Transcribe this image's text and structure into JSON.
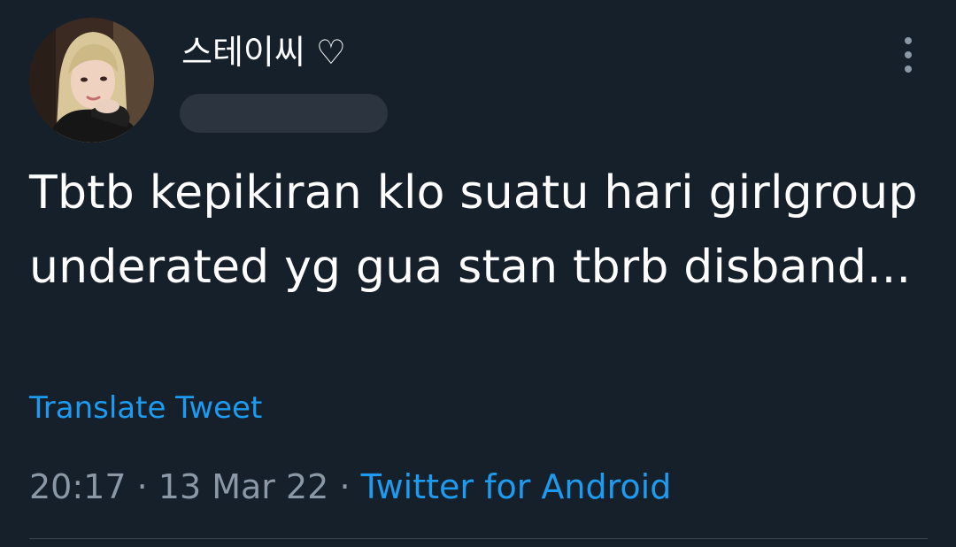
{
  "tweet": {
    "display_name": "스테이씨 ♡",
    "text": "Tbtb kepikiran klo suatu hari girlgroup underated yg gua stan tbrb disband...",
    "translate_label": "Translate Tweet",
    "time": "20:17",
    "separator": "·",
    "date": "13 Mar 22",
    "source": "Twitter for Android"
  },
  "icons": {
    "more": "more-vertical-icon"
  },
  "colors": {
    "background": "#15202b",
    "text": "#ffffff",
    "muted": "#8b98a5",
    "link": "#1d9bf0",
    "redaction": "#2b343f",
    "divider": "#38444d"
  }
}
